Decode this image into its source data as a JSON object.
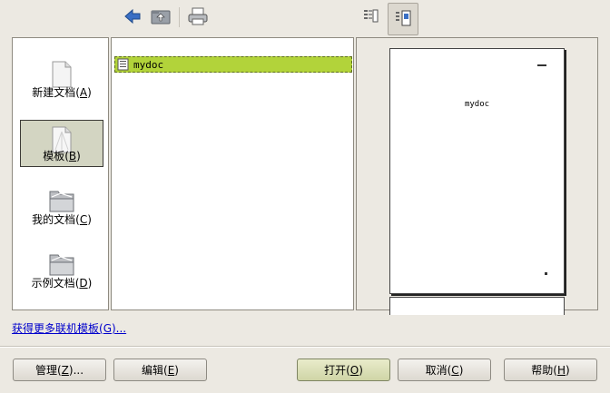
{
  "toolbar": {
    "icons": [
      "back-arrow-icon",
      "up-folder-icon",
      "print-icon",
      "list-view-icon",
      "preview-view-icon"
    ]
  },
  "categories": [
    {
      "name": "新建文档",
      "key": "A"
    },
    {
      "name": "模板",
      "key": "B"
    },
    {
      "name": "我的文档",
      "key": "C"
    },
    {
      "name": "示例文档",
      "key": "D"
    }
  ],
  "files": [
    {
      "name": "mydoc"
    }
  ],
  "preview": {
    "title": "mydoc"
  },
  "online_link": {
    "text": "获得更多联机模板(G)...",
    "pre": "获得更多联机模板(",
    "key": "G",
    "post": ")..."
  },
  "buttons": {
    "manage": {
      "pre": "管理(",
      "key": "Z",
      "post": ")..."
    },
    "edit": {
      "pre": "编辑(",
      "key": "E",
      "post": ")"
    },
    "open": {
      "pre": "打开(",
      "key": "O",
      "post": ")"
    },
    "cancel": {
      "pre": "取消(",
      "key": "C",
      "post": ")"
    },
    "help": {
      "pre": "帮助(",
      "key": "H",
      "post": ")"
    }
  },
  "colors": {
    "selection": "#b2d33a",
    "link": "#0000cc",
    "window_bg": "#ece9e2"
  }
}
